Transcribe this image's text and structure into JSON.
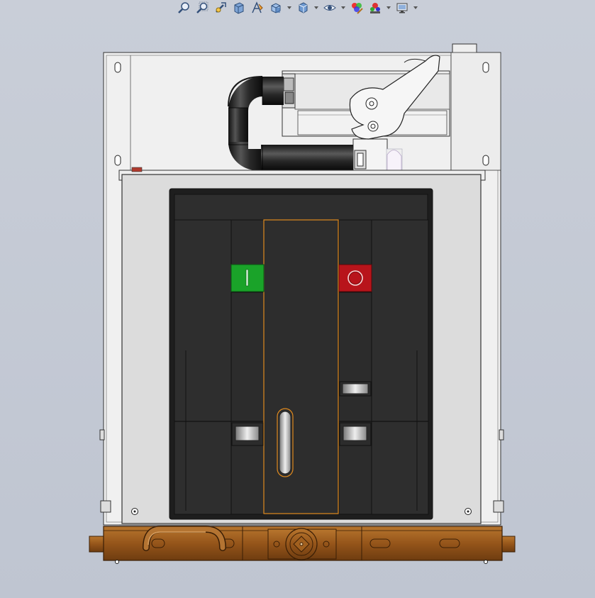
{
  "toolbar": {
    "items": [
      {
        "icon": "zoom-to-fit-icon",
        "dropdown": false
      },
      {
        "icon": "zoom-to-area-icon",
        "dropdown": false
      },
      {
        "icon": "previous-view-icon",
        "dropdown": false
      },
      {
        "icon": "section-view-icon",
        "dropdown": false
      },
      {
        "icon": "dynamic-annotation-icon",
        "dropdown": false
      },
      {
        "icon": "view-orientation-icon",
        "dropdown": true
      },
      {
        "icon": "display-style-icon",
        "dropdown": true
      },
      {
        "icon": "hide-show-items-icon",
        "dropdown": true
      },
      {
        "icon": "edit-appearance-icon",
        "dropdown": false
      },
      {
        "icon": "apply-scene-icon",
        "dropdown": true
      },
      {
        "icon": "view-settings-icon",
        "dropdown": true
      }
    ]
  },
  "model": {
    "name": "vacuum-circuit-breaker-front-view",
    "colors": {
      "background": "#c3c8d3",
      "frame": "#e6e6e6",
      "panel_dark": "#2c2c2c",
      "on_button": "#1aa329",
      "off_button": "#b8141b",
      "base_bronze": "#9a5a1c",
      "highlight_edge": "#e08a1e",
      "hose": "#2a2a2a"
    }
  }
}
